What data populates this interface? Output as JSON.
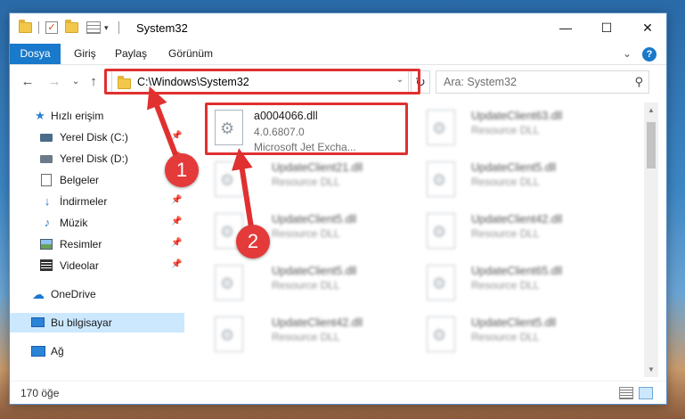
{
  "window": {
    "title": "System32",
    "controls": {
      "minimize": "—",
      "maximize": "☐",
      "close": "✕"
    }
  },
  "ribbon": {
    "tabs": [
      "Dosya",
      "Giriş",
      "Paylaş",
      "Görünüm"
    ],
    "expand_glyph": "⌄",
    "help": "?"
  },
  "address": {
    "path": "C:\\Windows\\System32",
    "search_placeholder": "Ara: System32"
  },
  "nav": {
    "quick_access": "Hızlı erişim",
    "items": [
      {
        "label": "Yerel Disk (C:)",
        "icon": "drive-icon",
        "pinned": true
      },
      {
        "label": "Yerel Disk (D:)",
        "icon": "drive-icon",
        "pinned": true
      },
      {
        "label": "Belgeler",
        "icon": "documents-icon",
        "pinned": true
      },
      {
        "label": "İndirmeler",
        "icon": "download-icon",
        "pinned": true
      },
      {
        "label": "Müzik",
        "icon": "music-icon",
        "pinned": true
      },
      {
        "label": "Resimler",
        "icon": "pictures-icon",
        "pinned": true
      },
      {
        "label": "Videolar",
        "icon": "video-icon",
        "pinned": true
      }
    ],
    "onedrive": "OneDrive",
    "this_pc": "Bu bilgisayar",
    "network": "Ağ"
  },
  "files": {
    "highlighted": {
      "name": "a0004066.dll",
      "version": "4.0.6807.0",
      "description": "Microsoft Jet Excha..."
    },
    "col1": [
      {
        "name": "UpdateClient21.dll",
        "type": "Resource DLL"
      },
      {
        "name": "UpdateClient5.dll",
        "type": "Resource DLL"
      },
      {
        "name": "UpdateClient5.dll",
        "type": "Resource DLL"
      },
      {
        "name": "UpdateClient42.dll",
        "type": "Resource DLL"
      }
    ],
    "col2": [
      {
        "name": "UpdateClient63.dll",
        "type": "Resource DLL"
      },
      {
        "name": "UpdateClient5.dll",
        "type": "Resource DLL"
      },
      {
        "name": "UpdateClient42.dll",
        "type": "Resource DLL"
      },
      {
        "name": "UpdateClient65.dll",
        "type": "Resource DLL"
      },
      {
        "name": "UpdateClient5.dll",
        "type": "Resource DLL"
      }
    ]
  },
  "status": {
    "count": "170 öğe"
  },
  "annotations": {
    "badge1": "1",
    "badge2": "2",
    "color": "#e03030"
  }
}
